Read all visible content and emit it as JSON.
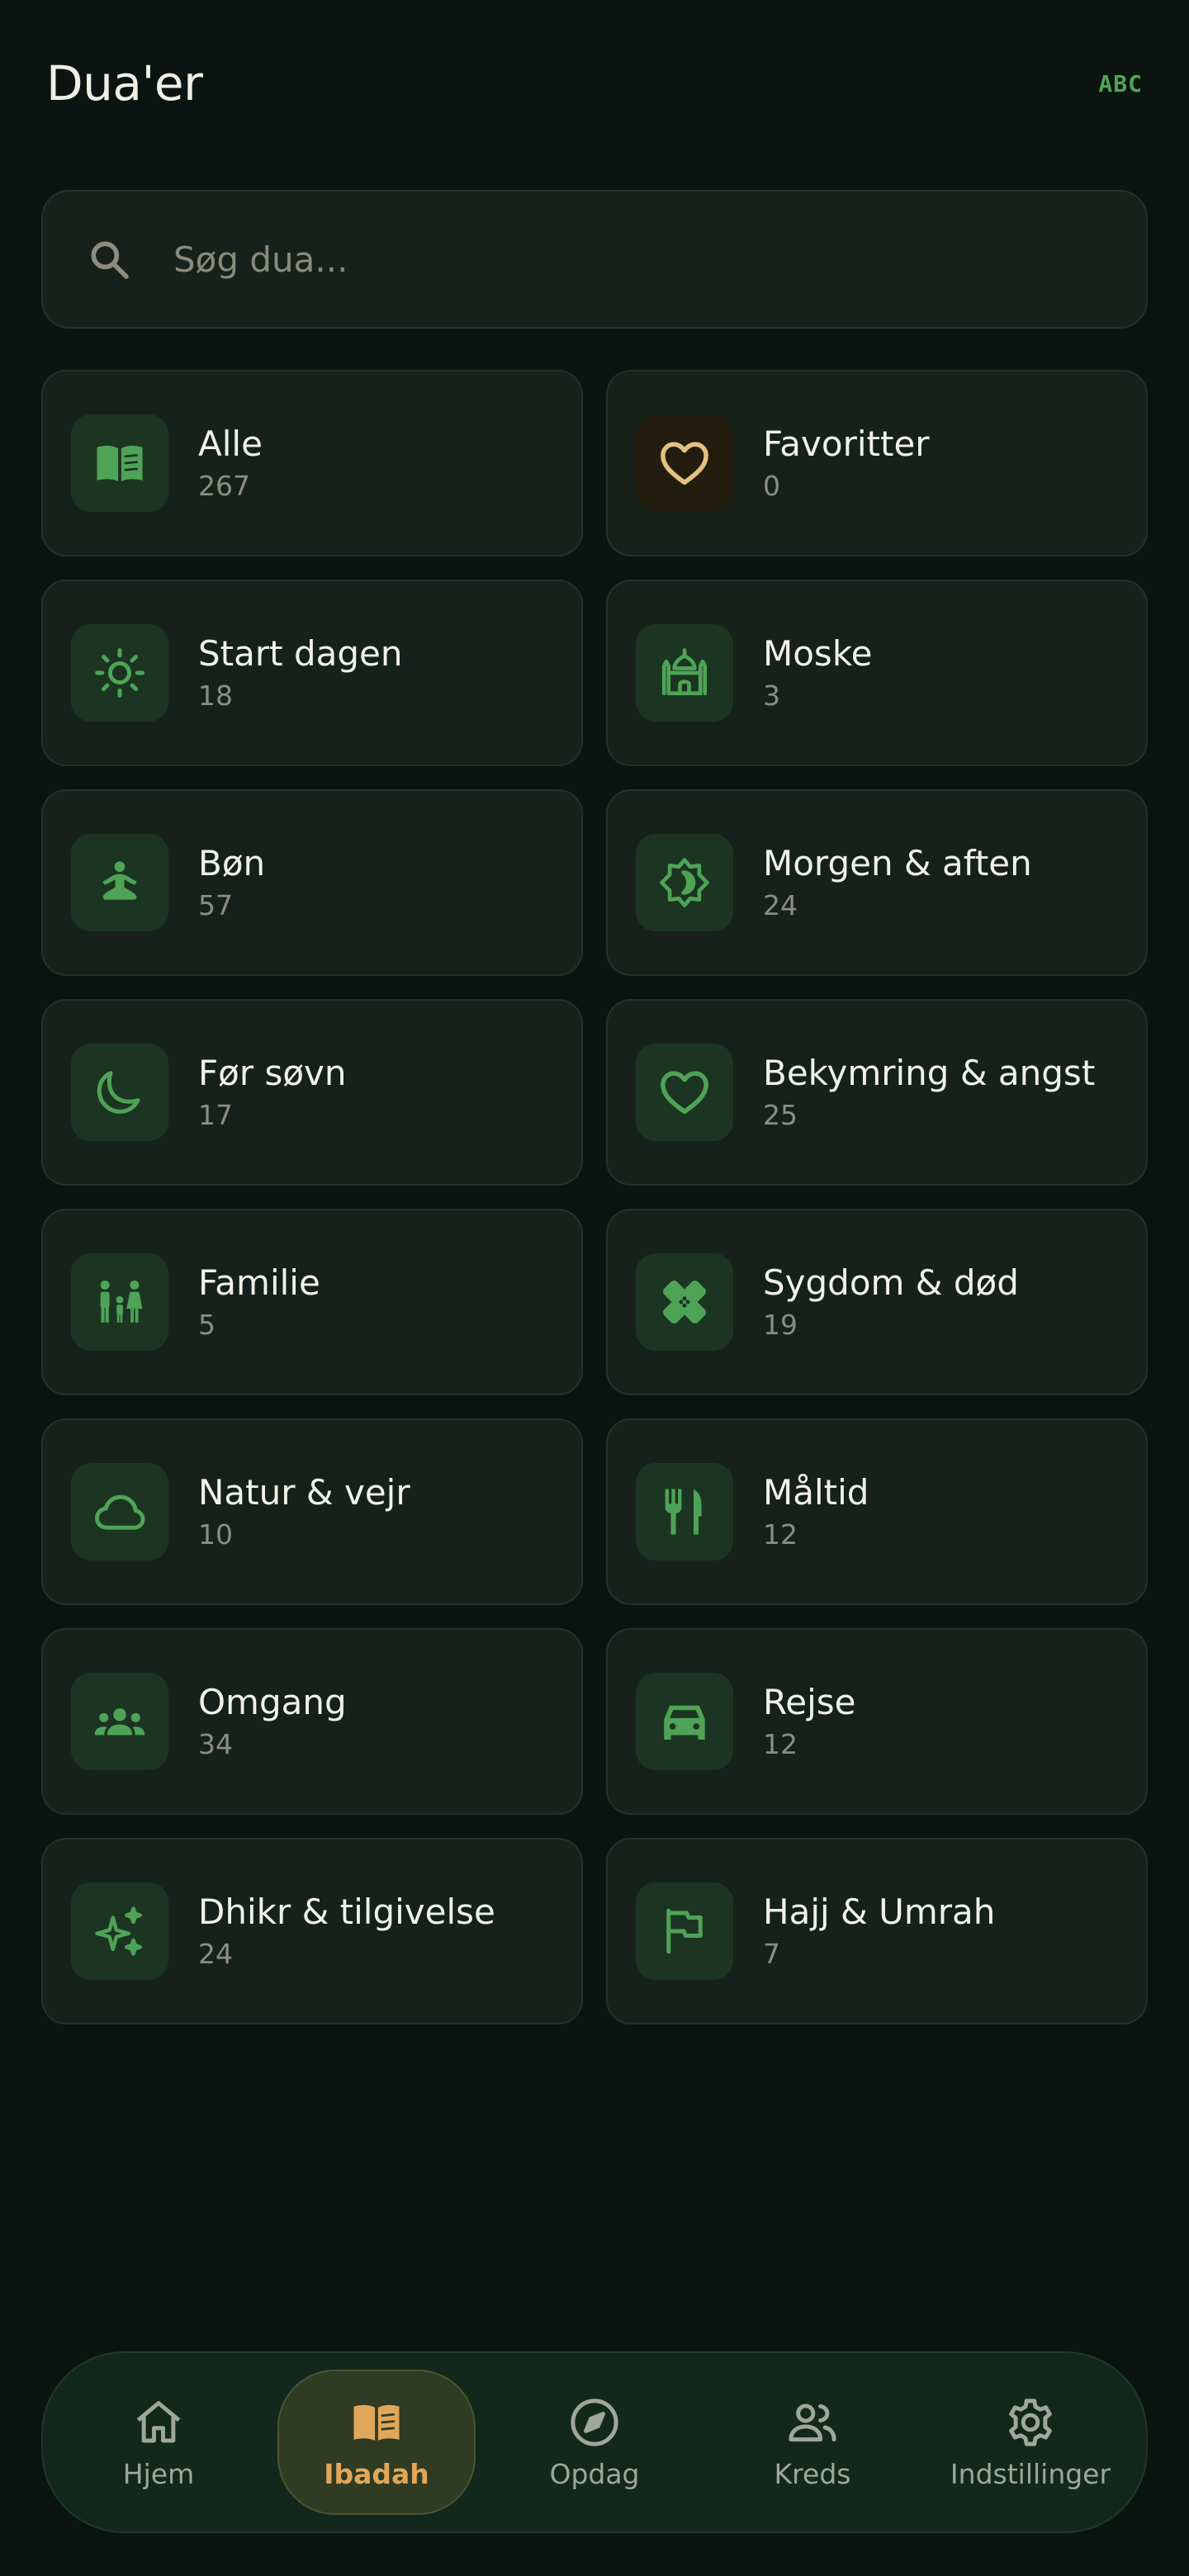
{
  "header": {
    "title": "Dua'er",
    "abc_toggle": "ABC"
  },
  "search": {
    "placeholder": "Søg dua..."
  },
  "categories": [
    {
      "label": "Alle",
      "count": "267",
      "icon": "open-book-icon"
    },
    {
      "label": "Favoritter",
      "count": "0",
      "icon": "heart-icon"
    },
    {
      "label": "Start dagen",
      "count": "18",
      "icon": "sun-icon"
    },
    {
      "label": "Moske",
      "count": "3",
      "icon": "mosque-icon"
    },
    {
      "label": "Bøn",
      "count": "57",
      "icon": "meditation-icon"
    },
    {
      "label": "Morgen & aften",
      "count": "24",
      "icon": "sun-moon-icon"
    },
    {
      "label": "Før søvn",
      "count": "17",
      "icon": "moon-icon"
    },
    {
      "label": "Bekymring & angst",
      "count": "25",
      "icon": "heart-outline-icon"
    },
    {
      "label": "Familie",
      "count": "5",
      "icon": "family-icon"
    },
    {
      "label": "Sygdom & død",
      "count": "19",
      "icon": "bandage-icon"
    },
    {
      "label": "Natur & vejr",
      "count": "10",
      "icon": "cloud-icon"
    },
    {
      "label": "Måltid",
      "count": "12",
      "icon": "utensils-icon"
    },
    {
      "label": "Omgang",
      "count": "34",
      "icon": "group-icon"
    },
    {
      "label": "Rejse",
      "count": "12",
      "icon": "car-icon"
    },
    {
      "label": "Dhikr & tilgivelse",
      "count": "24",
      "icon": "sparkles-icon"
    },
    {
      "label": "Hajj & Umrah",
      "count": "7",
      "icon": "flag-icon"
    }
  ],
  "nav": {
    "items": [
      {
        "label": "Hjem",
        "icon": "home-icon"
      },
      {
        "label": "Ibadah",
        "icon": "book-icon"
      },
      {
        "label": "Opdag",
        "icon": "compass-icon"
      },
      {
        "label": "Kreds",
        "icon": "people-icon"
      },
      {
        "label": "Indstillinger",
        "icon": "gear-icon"
      }
    ],
    "active_index": 1
  },
  "colors": {
    "background": "#0b1410",
    "card": "#16211c",
    "icon_green": "#4fa357",
    "accent_gold": "#e0a75a",
    "favorite_gold": "#e3c27f"
  }
}
